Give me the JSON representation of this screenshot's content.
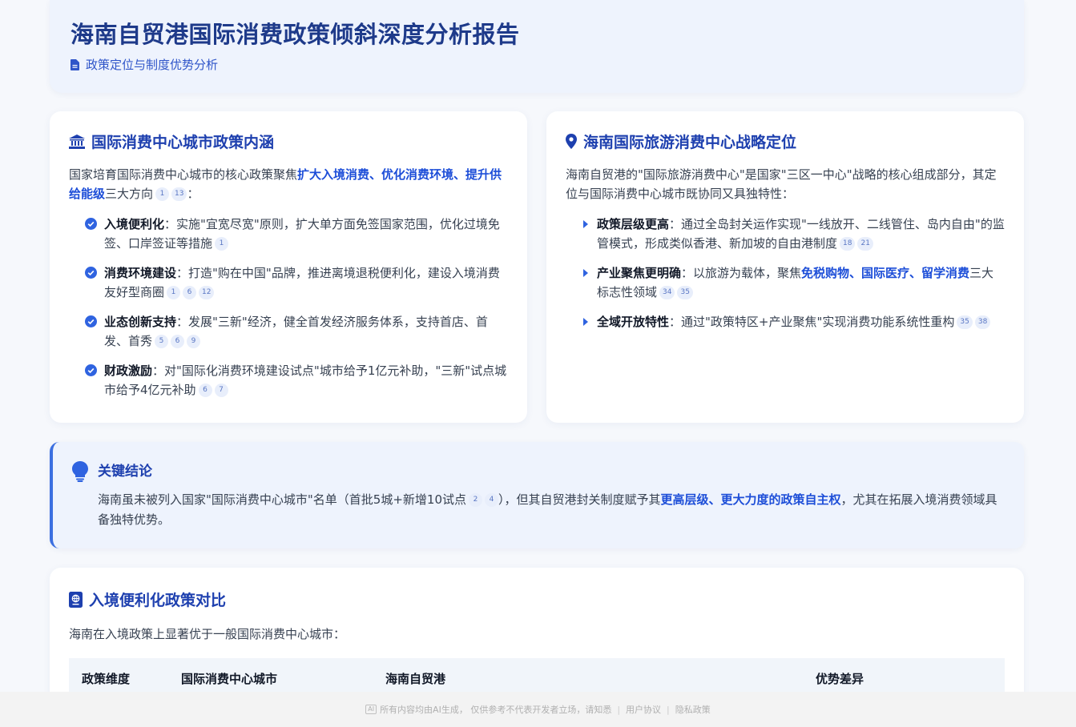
{
  "header": {
    "title": "海南自贸港国际消费政策倾斜深度分析报告",
    "subtitle": "政策定位与制度优势分析"
  },
  "left_card": {
    "title": "国际消费中心城市政策内涵",
    "intro_plain": "国家培育国际消费中心城市的核心政策聚焦",
    "intro_highlight": "扩大入境消费、优化消费环境、提升供给能级",
    "intro_tail": "三大方向",
    "intro_cites": [
      "1",
      "13"
    ],
    "intro_colon": "：",
    "items": [
      {
        "lead": "入境便利化",
        "text": "：实施\"宜宽尽宽\"原则，扩大单方面免签国家范围，优化过境免签、口岸签证等措施",
        "cites": [
          "1"
        ]
      },
      {
        "lead": "消费环境建设",
        "text": "：打造\"购在中国\"品牌，推进离境退税便利化，建设入境消费友好型商圈",
        "cites": [
          "1",
          "6",
          "12"
        ]
      },
      {
        "lead": "业态创新支持",
        "text": "：发展\"三新\"经济，健全首发经济服务体系，支持首店、首发、首秀",
        "cites": [
          "5",
          "6",
          "9"
        ]
      },
      {
        "lead": "财政激励",
        "text": "：对\"国际化消费环境建设试点\"城市给予1亿元补助，\"三新\"试点城市给予4亿元补助",
        "cites": [
          "6",
          "7"
        ]
      }
    ]
  },
  "right_card": {
    "title": "海南国际旅游消费中心战略定位",
    "intro": "海南自贸港的\"国际旅游消费中心\"是国家\"三区一中心\"战略的核心组成部分，其定位与国际消费中心城市既协同又具独特性：",
    "items": [
      {
        "lead": "政策层级更高",
        "text": "：通过全岛封关运作实现\"一线放开、二线管住、岛内自由\"的监管模式，形成类似香港、新加坡的自由港制度",
        "cites": [
          "18",
          "21"
        ]
      },
      {
        "lead": "产业聚焦更明确",
        "text_before": "：以旅游为载体，聚焦",
        "highlight": "免税购物、国际医疗、留学消费",
        "text_after": "三大标志性领域",
        "cites": [
          "34",
          "35"
        ]
      },
      {
        "lead": "全域开放特性",
        "text": "：通过\"政策特区+产业聚焦\"实现消费功能系统性重构",
        "cites": [
          "35",
          "38"
        ]
      }
    ]
  },
  "conclusion": {
    "title": "关键结论",
    "text_before": "海南虽未被列入国家\"国际消费中心城市\"名单（首批5城+新增10试点",
    "cites": [
      "2",
      "4"
    ],
    "text_mid": "），但其自贸港封关制度赋予其",
    "highlight": "更高层级、更大力度的政策自主权",
    "text_after": "，尤其在拓展入境消费领域具备独特优势。"
  },
  "compare": {
    "title": "入境便利化政策对比",
    "intro": "海南在入境政策上显著优于一般国际消费中心城市：",
    "columns": [
      "政策维度",
      "国际消费中心城市",
      "海南自贸港",
      "优势差异"
    ]
  },
  "footer": {
    "ai_badge": "AI",
    "disclaimer": "所有内容均由AI生成， 仅供参考不代表开发者立场，请知悉",
    "user_agreement": "用户协议",
    "privacy": "隐私政策"
  },
  "colors": {
    "title_blue": "#1e3a8a",
    "accent_blue": "#1d4ed8",
    "card_bg": "#ffffff",
    "tint_bg": "#eef3fd"
  }
}
